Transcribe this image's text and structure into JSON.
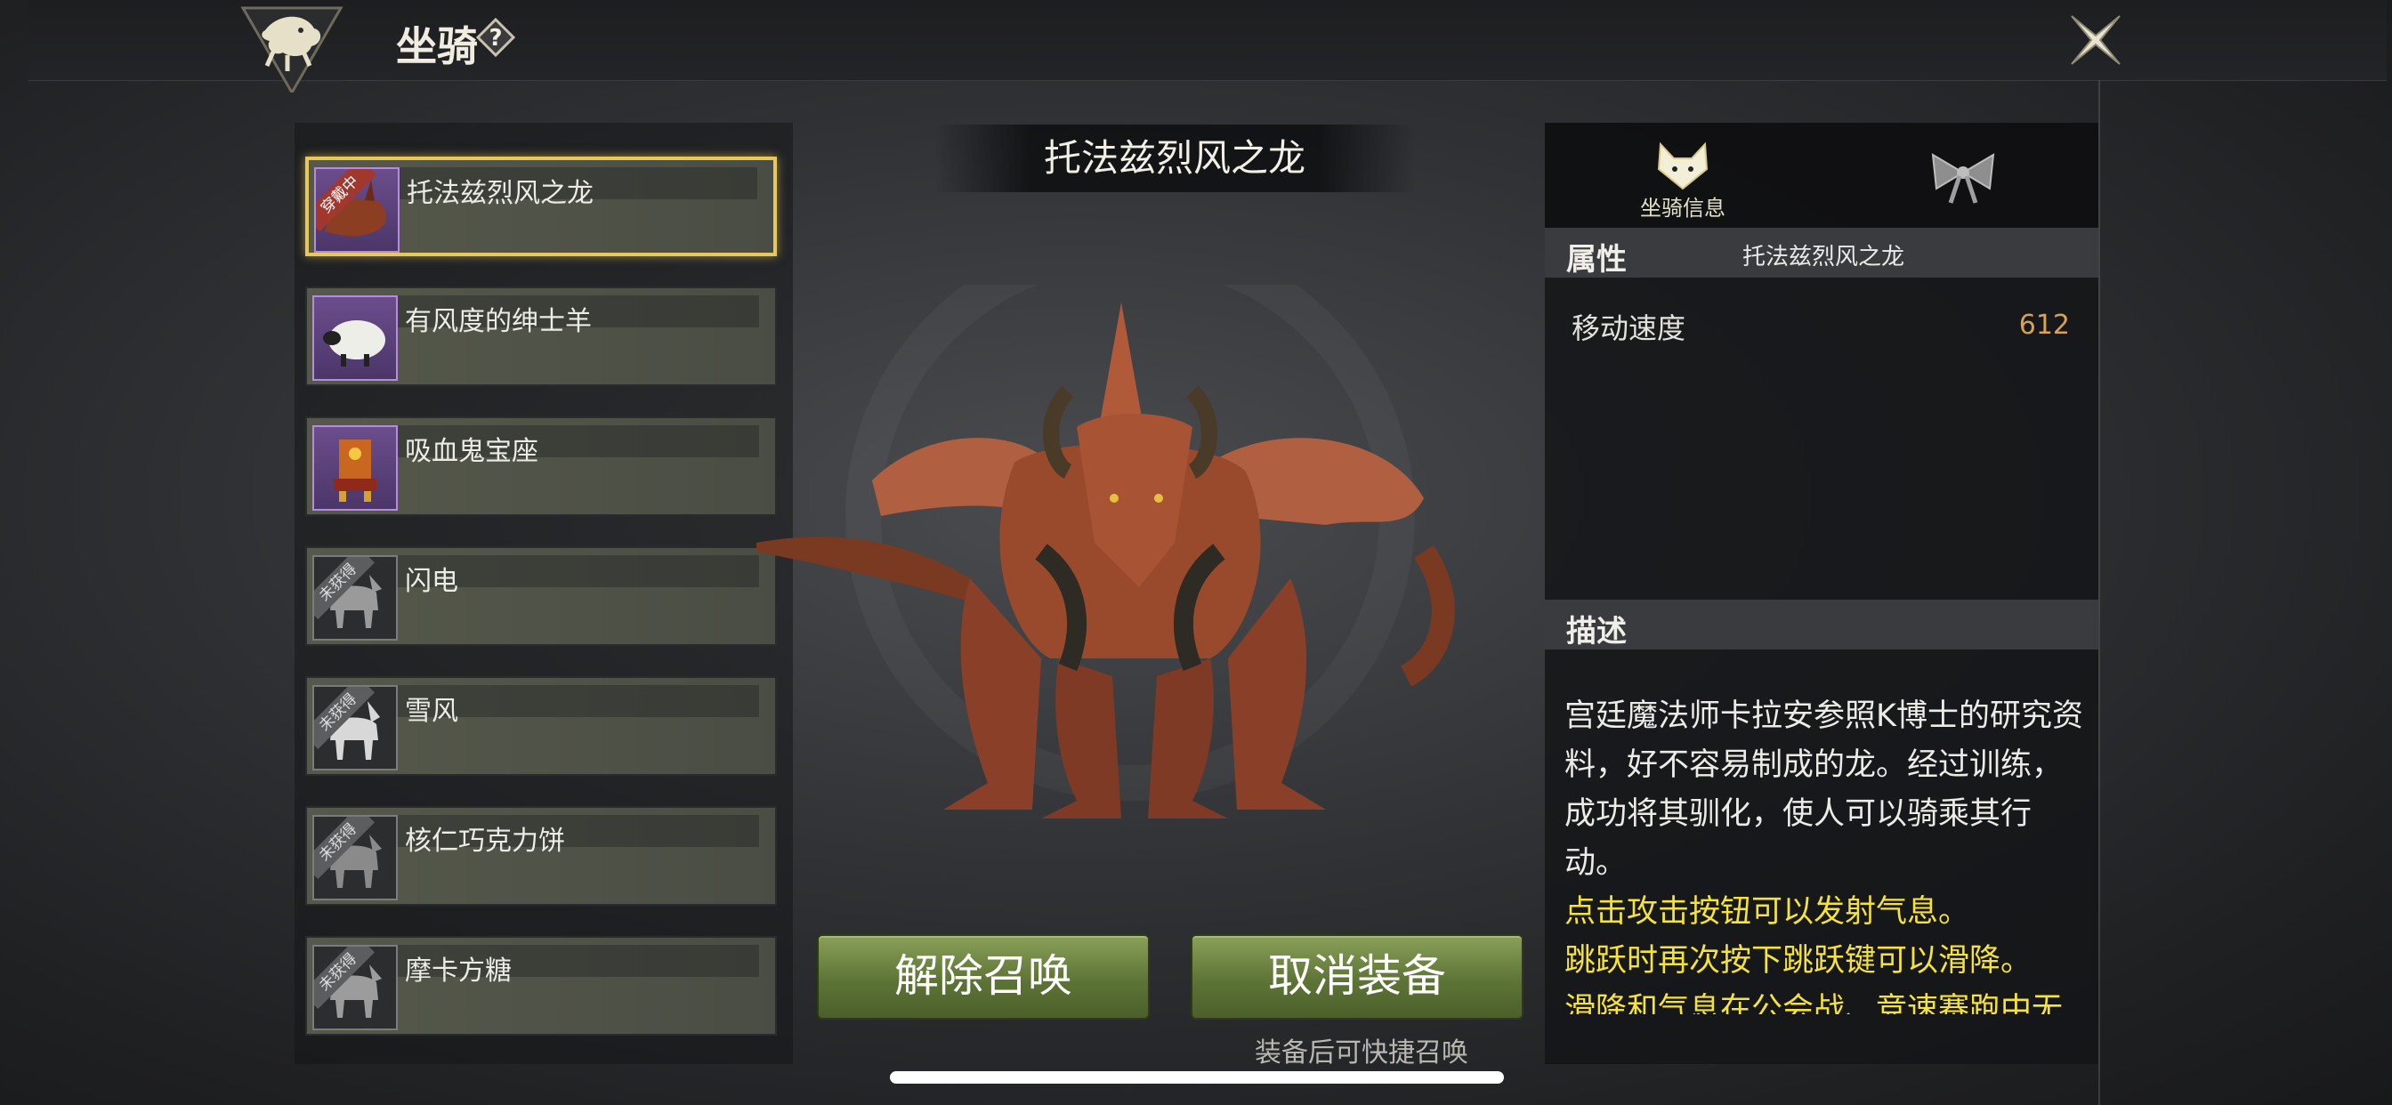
{
  "header": {
    "title": "坐骑",
    "help_icon": "question-diamond-icon",
    "close_icon": "close-x-icon",
    "logo_icon": "dragon-emblem-icon"
  },
  "mount_list": [
    {
      "name": "托法兹烈风之龙",
      "badge": "穿戴中",
      "owned": true,
      "selected": true
    },
    {
      "name": "有风度的绅士羊",
      "badge": "",
      "owned": true,
      "selected": false
    },
    {
      "name": "吸血鬼宝座",
      "badge": "",
      "owned": true,
      "selected": false
    },
    {
      "name": "闪电",
      "badge": "未获得",
      "owned": false,
      "selected": false
    },
    {
      "name": "雪风",
      "badge": "未获得",
      "owned": false,
      "selected": false
    },
    {
      "name": "核仁巧克力饼",
      "badge": "未获得",
      "owned": false,
      "selected": false
    },
    {
      "name": "摩卡方糖",
      "badge": "未获得",
      "owned": false,
      "selected": false
    }
  ],
  "preview": {
    "mount_name": "托法兹烈风之龙",
    "buttons": {
      "unsummon": "解除召唤",
      "unequip": "取消装备"
    },
    "hint": "装备后可快捷召唤"
  },
  "info_panel": {
    "tabs": {
      "info_label": "坐骑信息",
      "info_icon": "fox-head-icon",
      "appearance_icon": "bow-icon"
    },
    "attributes": {
      "heading": "属性",
      "mount_name": "托法兹烈风之龙",
      "stat_label": "移动速度",
      "stat_value": "612"
    },
    "description": {
      "heading": "描述",
      "text": "宫廷魔法师卡拉安参照K博士的研究资料，好不容易制成的龙。经过训练，成功将其驯化，使人可以骑乘其行动。",
      "tip1": "点击攻击按钮可以发射气息。",
      "tip2": "跳跃时再次按下跳跃键可以滑降。",
      "tip3": "滑降和气息在公会战、竞速赛跑中无"
    }
  },
  "colors": {
    "selected_border": "#e8c85a",
    "button_green": "#5d7436",
    "tip_yellow": "#f5e23a",
    "stat_orange": "#d9a24c"
  }
}
